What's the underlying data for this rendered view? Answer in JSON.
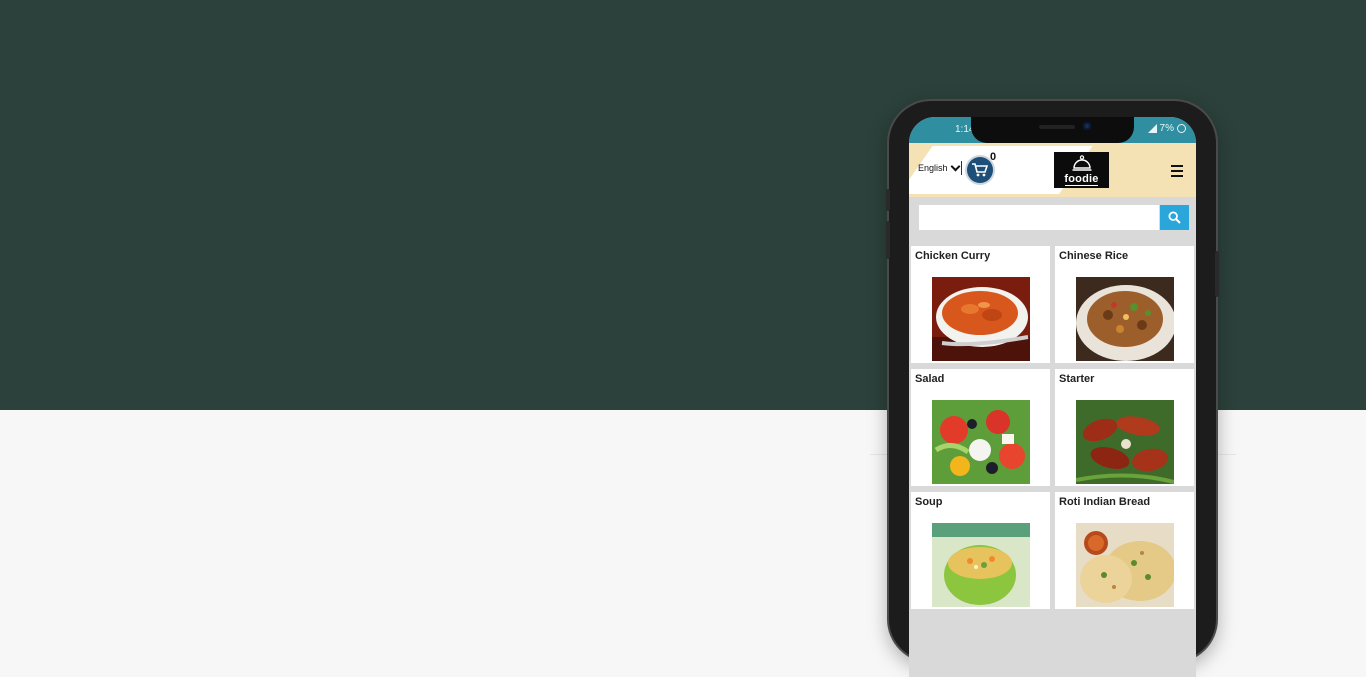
{
  "phone": {
    "status": {
      "time": "1:14",
      "battery": "7%"
    },
    "header": {
      "language": "English",
      "cart_count": "0",
      "logo_text": "foodie"
    },
    "search": {
      "placeholder": "",
      "value": ""
    },
    "categories": [
      {
        "label": "Chicken Curry",
        "image": "chicken-curry"
      },
      {
        "label": "Chinese Rice",
        "image": "chinese-rice"
      },
      {
        "label": "Salad",
        "image": "salad"
      },
      {
        "label": "Starter",
        "image": "starter"
      },
      {
        "label": "Soup",
        "image": "soup"
      },
      {
        "label": "Roti Indian Bread",
        "image": "roti-indian-bread"
      }
    ]
  },
  "colors": {
    "hero": "#2c413b",
    "background": "#f7f7f7",
    "statusbar": "#2f8fa0",
    "header": "#f4e2b5",
    "search_button": "#2aa6db",
    "cart": "#1d4f78"
  },
  "icons": [
    "chevron-down-icon",
    "cart-icon",
    "cloche-icon",
    "hamburger-menu-icon",
    "search-icon",
    "signal-icon",
    "battery-clock-icon"
  ]
}
